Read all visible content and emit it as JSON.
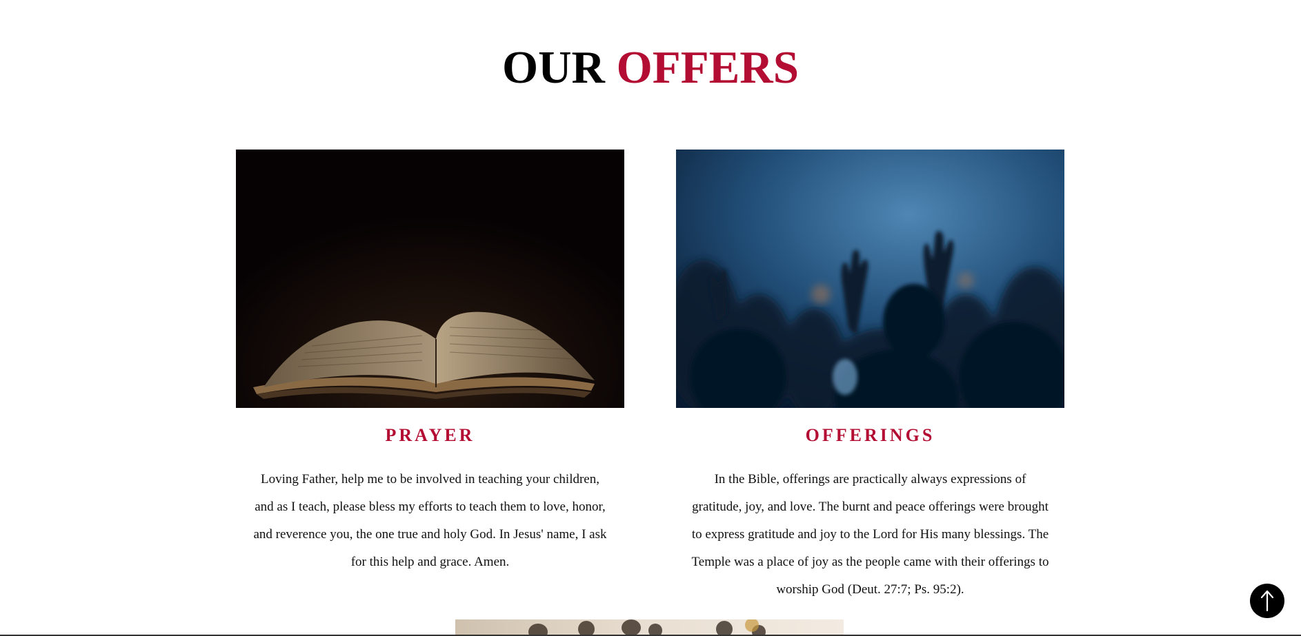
{
  "section": {
    "title_part1": "OUR",
    "title_part2": "OFFERS"
  },
  "cards": [
    {
      "title": "PRAYER",
      "text": "Loving Father, help me to be involved in teaching your children, and as I teach, please bless my efforts to teach them to love, honor, and reverence you, the one true and holy God. In Jesus' name, I ask for this help and grace. Amen.",
      "image": "open-bible-dark"
    },
    {
      "title": "OFFERINGS",
      "text": "In the Bible, offerings are practically always expressions of gratitude, joy, and love. The burnt and peace offerings were brought to express gratitude and joy to the Lord for His many blessings. The Temple was a place of joy as the people came with their offerings to worship God (Deut. 27:7; Ps. 95:2).",
      "image": "raised-hands-worship"
    }
  ],
  "scroll_top": {
    "icon": "arrow-up-icon"
  },
  "colors": {
    "accent": "#b30d33",
    "text": "#111111",
    "background": "#ffffff"
  }
}
